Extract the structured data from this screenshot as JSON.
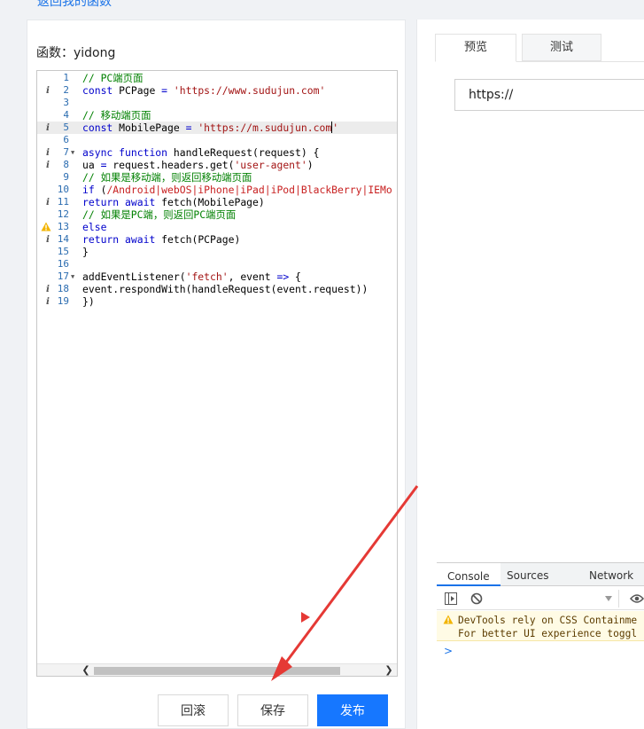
{
  "header": {
    "back_link": "返回我的函数"
  },
  "function": {
    "label": "函数：",
    "name": "yidong"
  },
  "editor": {
    "lines": [
      {
        "n": "1",
        "mark": "",
        "fold": false,
        "active": false,
        "parts": [
          {
            "t": "// PC端页面",
            "c": "com"
          }
        ]
      },
      {
        "n": "2",
        "mark": "info",
        "fold": false,
        "active": false,
        "parts": [
          {
            "t": "const",
            "c": "kw"
          },
          {
            "t": " PCPage ",
            "c": ""
          },
          {
            "t": "=",
            "c": "kw"
          },
          {
            "t": " ",
            "c": ""
          },
          {
            "t": "'https://www.sudujun.com'",
            "c": "str"
          }
        ]
      },
      {
        "n": "3",
        "mark": "",
        "fold": false,
        "active": false,
        "parts": []
      },
      {
        "n": "4",
        "mark": "",
        "fold": false,
        "active": false,
        "parts": [
          {
            "t": "// 移动端页面",
            "c": "com"
          }
        ]
      },
      {
        "n": "5",
        "mark": "info",
        "fold": false,
        "active": true,
        "parts": [
          {
            "t": "const",
            "c": "kw"
          },
          {
            "t": " MobilePage ",
            "c": ""
          },
          {
            "t": "=",
            "c": "kw"
          },
          {
            "t": " ",
            "c": ""
          },
          {
            "t": "'https://m.sudujun.com",
            "c": "str"
          },
          {
            "t": "|",
            "c": "cursor"
          },
          {
            "t": "'",
            "c": "str"
          }
        ]
      },
      {
        "n": "6",
        "mark": "",
        "fold": false,
        "active": false,
        "parts": []
      },
      {
        "n": "7",
        "mark": "info",
        "fold": true,
        "active": false,
        "parts": [
          {
            "t": "async",
            "c": "kw"
          },
          {
            "t": " ",
            "c": ""
          },
          {
            "t": "function",
            "c": "kw"
          },
          {
            "t": " handleRequest(request) {",
            "c": ""
          }
        ]
      },
      {
        "n": "8",
        "mark": "info",
        "fold": false,
        "active": false,
        "parts": [
          {
            "t": "ua ",
            "c": ""
          },
          {
            "t": "=",
            "c": "kw"
          },
          {
            "t": " request.headers.get(",
            "c": ""
          },
          {
            "t": "'user-agent'",
            "c": "str"
          },
          {
            "t": ")",
            "c": ""
          }
        ]
      },
      {
        "n": "9",
        "mark": "",
        "fold": false,
        "active": false,
        "parts": [
          {
            "t": "// 如果是移动端，则返回移动端页面",
            "c": "com"
          }
        ]
      },
      {
        "n": "10",
        "mark": "",
        "fold": false,
        "active": false,
        "parts": [
          {
            "t": "if",
            "c": "kw"
          },
          {
            "t": " (",
            "c": ""
          },
          {
            "t": "/Android|webOS|iPhone|iPad|iPod|BlackBerry|IEMo",
            "c": "re"
          }
        ]
      },
      {
        "n": "11",
        "mark": "info",
        "fold": false,
        "active": false,
        "parts": [
          {
            "t": "return",
            "c": "kw"
          },
          {
            "t": " ",
            "c": ""
          },
          {
            "t": "await",
            "c": "kw"
          },
          {
            "t": " fetch(MobilePage)",
            "c": ""
          }
        ]
      },
      {
        "n": "12",
        "mark": "",
        "fold": false,
        "active": false,
        "parts": [
          {
            "t": "// 如果是PC端，则返回PC端页面",
            "c": "com"
          }
        ]
      },
      {
        "n": "13",
        "mark": "warn",
        "fold": false,
        "active": false,
        "parts": [
          {
            "t": "else",
            "c": "kw"
          }
        ]
      },
      {
        "n": "14",
        "mark": "info",
        "fold": false,
        "active": false,
        "parts": [
          {
            "t": "return",
            "c": "kw"
          },
          {
            "t": " ",
            "c": ""
          },
          {
            "t": "await",
            "c": "kw"
          },
          {
            "t": " fetch(PCPage)",
            "c": ""
          }
        ]
      },
      {
        "n": "15",
        "mark": "",
        "fold": false,
        "active": false,
        "parts": [
          {
            "t": "}",
            "c": ""
          }
        ]
      },
      {
        "n": "16",
        "mark": "",
        "fold": false,
        "active": false,
        "parts": []
      },
      {
        "n": "17",
        "mark": "",
        "fold": true,
        "active": false,
        "parts": [
          {
            "t": "addEventListener(",
            "c": ""
          },
          {
            "t": "'fetch'",
            "c": "str"
          },
          {
            "t": ", event ",
            "c": ""
          },
          {
            "t": "=>",
            "c": "kw"
          },
          {
            "t": " {",
            "c": ""
          }
        ]
      },
      {
        "n": "18",
        "mark": "info",
        "fold": false,
        "active": false,
        "parts": [
          {
            "t": "event.respondWith(handleRequest(event.request))",
            "c": ""
          }
        ]
      },
      {
        "n": "19",
        "mark": "info",
        "fold": false,
        "active": false,
        "parts": [
          {
            "t": "})",
            "c": ""
          }
        ]
      }
    ]
  },
  "actions": {
    "rollback": "回滚",
    "save": "保存",
    "publish": "发布"
  },
  "preview": {
    "tabs": [
      {
        "label": "预览",
        "active": true
      },
      {
        "label": "测试",
        "active": false
      }
    ],
    "url": "https://"
  },
  "devtools": {
    "tabs": [
      {
        "label": "Console",
        "active": true
      },
      {
        "label": "Sources",
        "active": false
      },
      {
        "label": "Network",
        "active": false
      }
    ],
    "warning_line1": "DevTools rely on CSS Containme",
    "warning_line2": "For better UI experience toggl",
    "prompt": ">"
  },
  "colors": {
    "primary": "#1677ff",
    "link": "#1a73e8",
    "annotation_arrow": "#e53935"
  }
}
